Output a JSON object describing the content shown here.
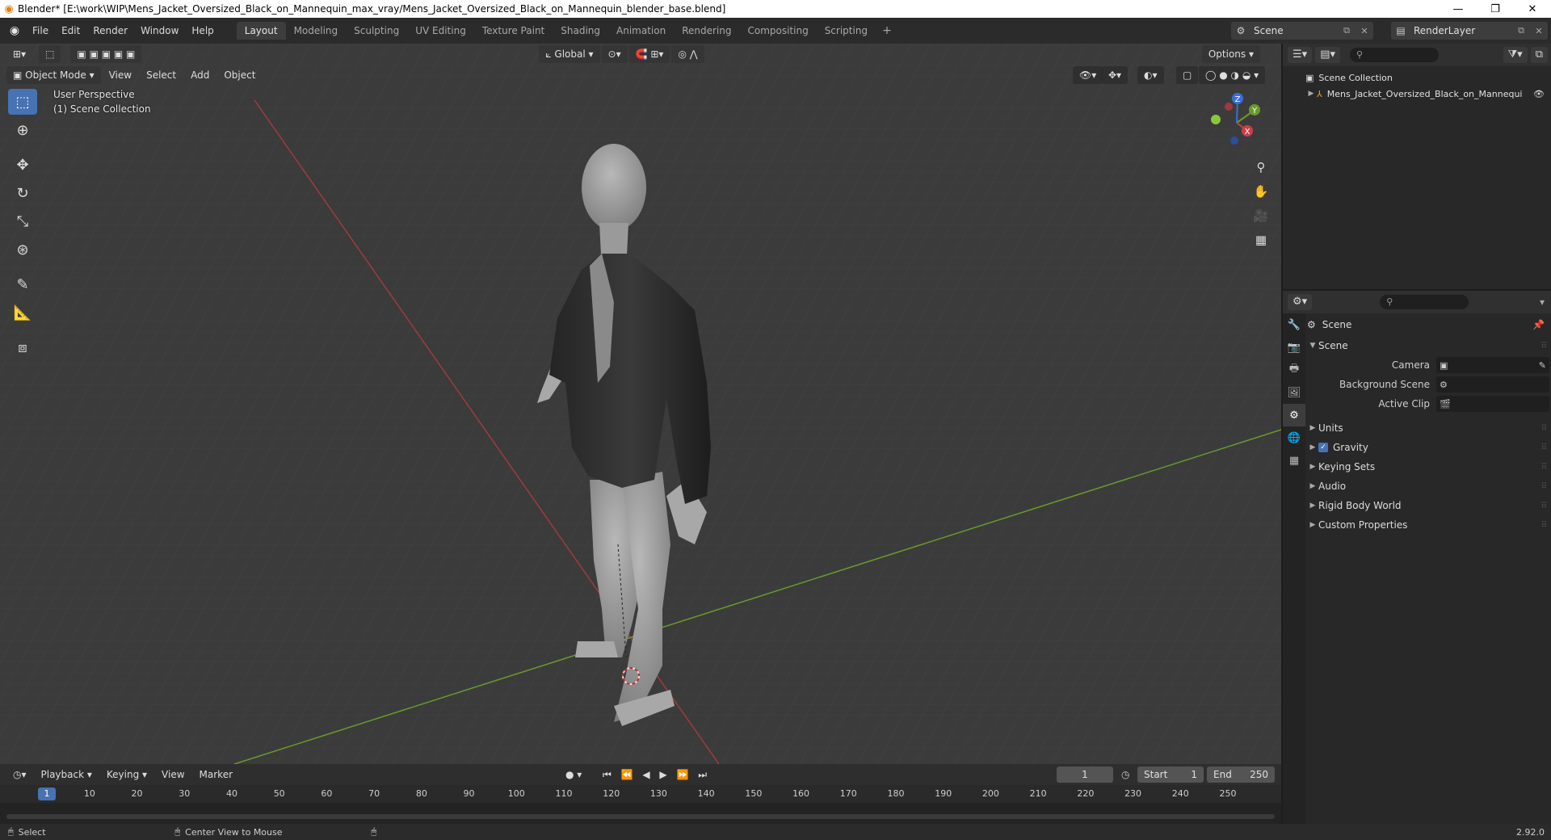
{
  "window": {
    "title": "Blender* [E:\\work\\WIP\\Mens_Jacket_Oversized_Black_on_Mannequin_max_vray/Mens_Jacket_Oversized_Black_on_Mannequin_blender_base.blend]",
    "minimize": "—",
    "maximize": "❐",
    "close": "✕"
  },
  "menu": [
    "File",
    "Edit",
    "Render",
    "Window",
    "Help"
  ],
  "workspaces": [
    "Layout",
    "Modeling",
    "Sculpting",
    "UV Editing",
    "Texture Paint",
    "Shading",
    "Animation",
    "Rendering",
    "Compositing",
    "Scripting"
  ],
  "workspace_add": "+",
  "scene_selector": {
    "value": "Scene"
  },
  "view_layer_selector": {
    "value": "RenderLayer"
  },
  "viewport": {
    "mode": "Object Mode",
    "menus": [
      "View",
      "Select",
      "Add",
      "Object"
    ],
    "orientation": "Global",
    "options": "Options",
    "perspective_label": "User Perspective",
    "collection_label": "(1) Scene Collection",
    "gizmo": {
      "x": "X",
      "y": "Y",
      "z": "Z"
    }
  },
  "outliner": {
    "search_placeholder": "",
    "root": "Scene Collection",
    "items": [
      "Mens_Jacket_Oversized_Black_on_Mannequi"
    ]
  },
  "properties": {
    "context": "Scene",
    "section": "Scene",
    "fields": [
      {
        "label": "Camera",
        "value": ""
      },
      {
        "label": "Background Scene",
        "value": ""
      },
      {
        "label": "Active Clip",
        "value": ""
      }
    ],
    "panels": [
      {
        "label": "Units",
        "checkbox": false
      },
      {
        "label": "Gravity",
        "checkbox": true
      },
      {
        "label": "Keying Sets",
        "checkbox": false
      },
      {
        "label": "Audio",
        "checkbox": false
      },
      {
        "label": "Rigid Body World",
        "checkbox": false
      },
      {
        "label": "Custom Properties",
        "checkbox": false
      }
    ]
  },
  "timeline": {
    "menus": [
      "Playback",
      "Keying",
      "View",
      "Marker"
    ],
    "current_frame": "1",
    "start_label": "Start",
    "start": "1",
    "end_label": "End",
    "end": "250",
    "ticks": [
      "10",
      "20",
      "30",
      "40",
      "50",
      "60",
      "70",
      "80",
      "90",
      "100",
      "110",
      "120",
      "130",
      "140",
      "150",
      "160",
      "170",
      "180",
      "190",
      "200",
      "210",
      "220",
      "230",
      "240",
      "250"
    ],
    "marker_label": "1"
  },
  "status": {
    "left": "Select",
    "middle": "Center View to Mouse",
    "version": "2.92.0"
  },
  "colors": {
    "accent": "#4772b3",
    "x_axis": "#a03a3f",
    "y_axis": "#6a9a2a",
    "z_axis": "#3a6fd8"
  }
}
